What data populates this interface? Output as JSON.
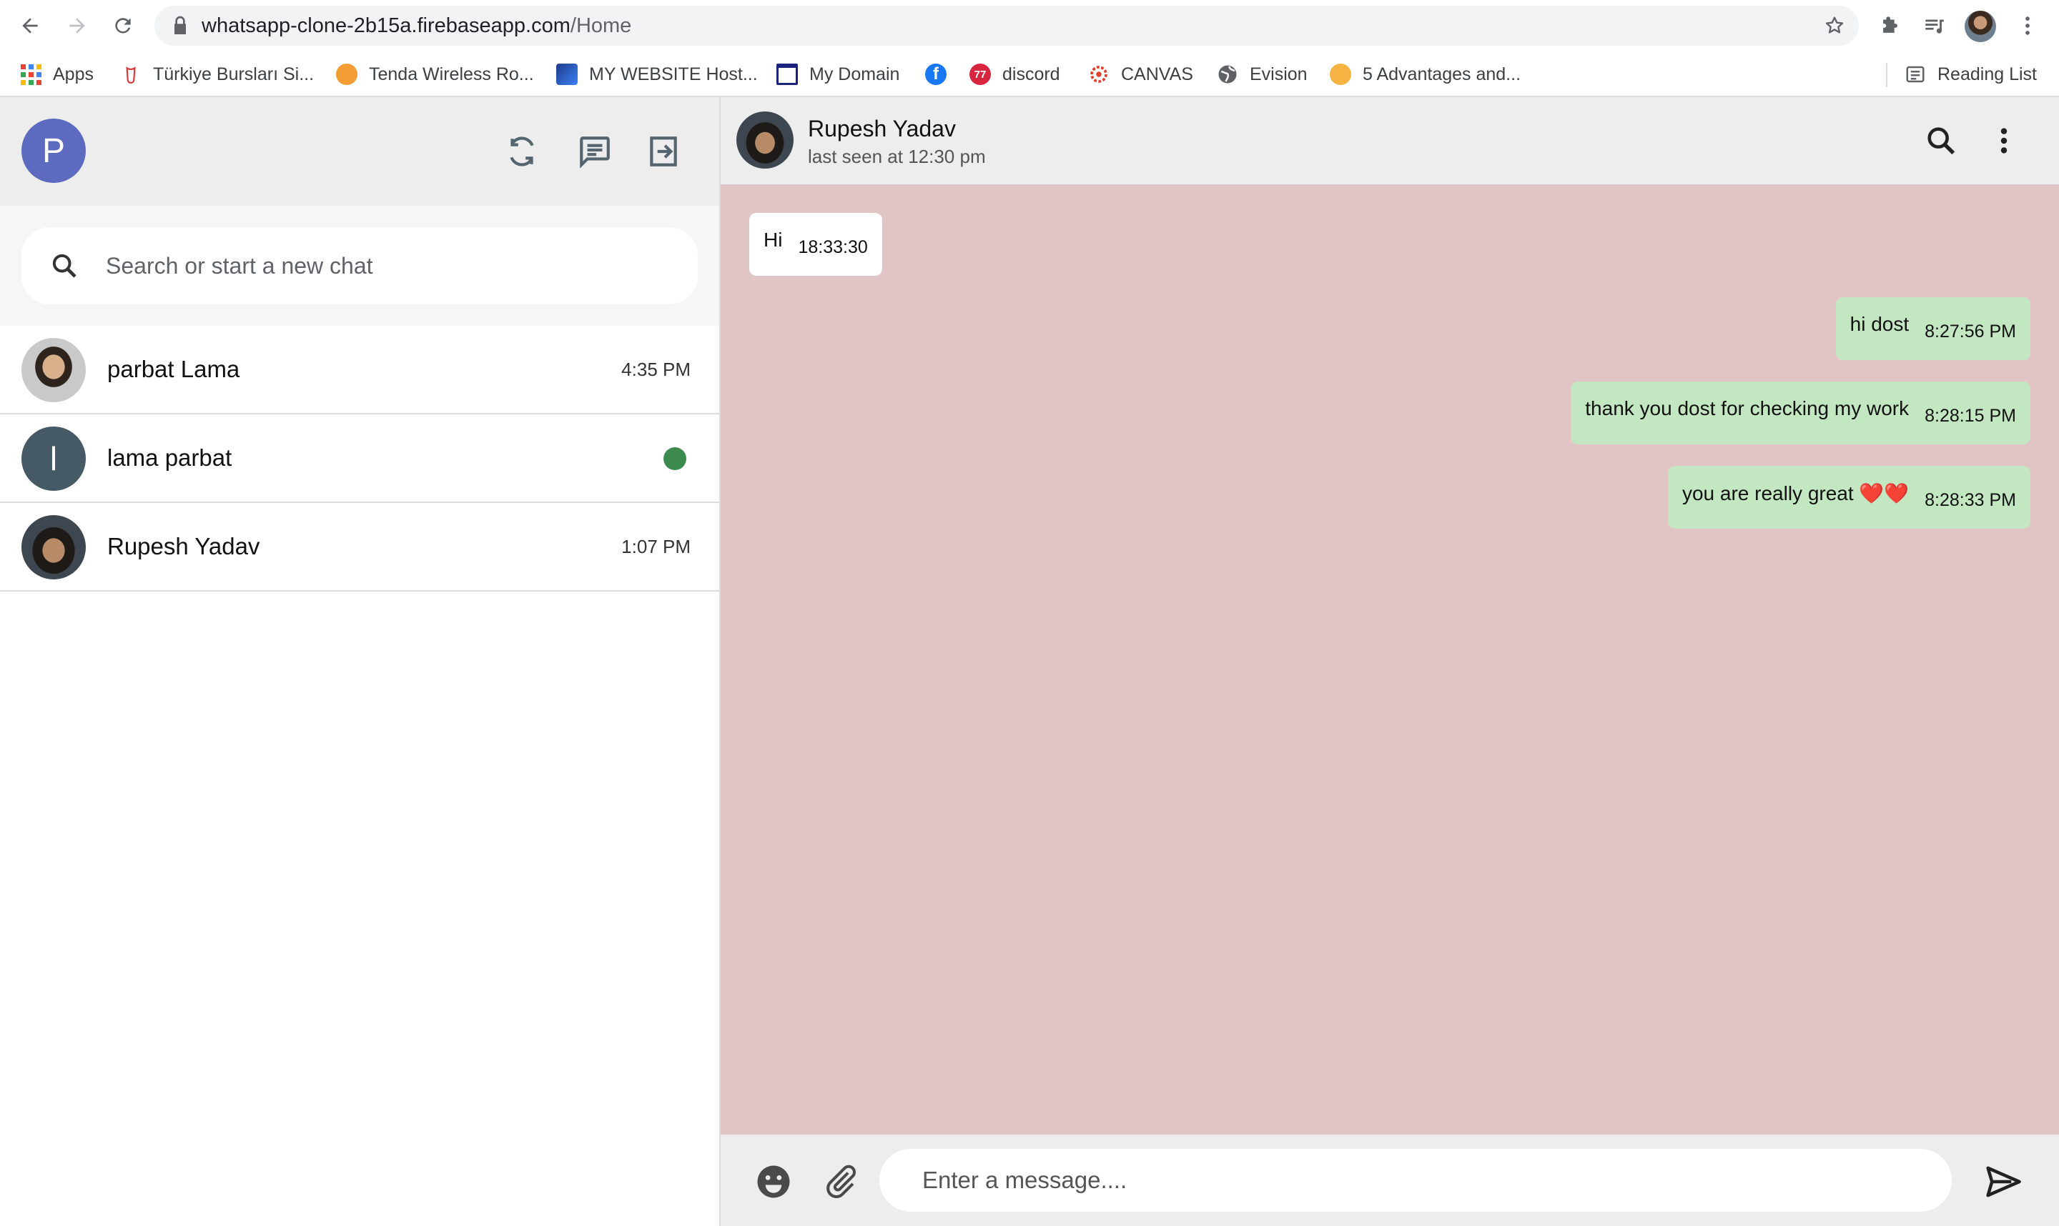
{
  "browser": {
    "url_host": "whatsapp-clone-2b15a.firebaseapp.com",
    "url_path": "/Home",
    "bookmarks": [
      {
        "label": "Apps",
        "icon": "apps-grid-icon"
      },
      {
        "label": "Türkiye Bursları Si...",
        "icon": "turkiye-burslari-icon"
      },
      {
        "label": "Tenda Wireless Ro...",
        "icon": "tenda-icon"
      },
      {
        "label": "MY WEBSITE Host...",
        "icon": "website-host-icon"
      },
      {
        "label": "My Domain",
        "icon": "domain-icon"
      },
      {
        "label": "",
        "icon": "facebook-icon"
      },
      {
        "label": "discord",
        "icon": "discord-icon"
      },
      {
        "label": "CANVAS",
        "icon": "canvas-icon"
      },
      {
        "label": "Evision",
        "icon": "globe-icon"
      },
      {
        "label": "5 Advantages and...",
        "icon": "advantages-icon"
      }
    ],
    "reading_list": "Reading List"
  },
  "sidebar": {
    "user_initial": "P",
    "search_placeholder": "Search or start a new chat",
    "chats": [
      {
        "name": "parbat Lama",
        "time": "4:35 PM",
        "avatar": "photo"
      },
      {
        "name": "lama parbat",
        "time": "",
        "avatar_letter": "l",
        "online": true
      },
      {
        "name": "Rupesh Yadav",
        "time": "1:07 PM",
        "avatar": "photo"
      }
    ]
  },
  "chat": {
    "contact_name": "Rupesh Yadav",
    "last_seen": "last seen at 12:30 pm",
    "messages": [
      {
        "direction": "in",
        "text": "Hi",
        "time": "18:33:30"
      },
      {
        "direction": "out",
        "text": "hi dost",
        "time": "8:27:56 PM"
      },
      {
        "direction": "out",
        "text": "thank you dost for checking my work",
        "time": "8:28:15 PM"
      },
      {
        "direction": "out",
        "text": "you are really great ❤️❤️",
        "time": "8:28:33 PM"
      }
    ],
    "input_placeholder": "Enter a message...."
  },
  "colors": {
    "chat_background": "#e1c4c6",
    "outgoing_bubble": "#c3e8c1",
    "incoming_bubble": "#ffffff",
    "user_avatar": "#5c6bc0",
    "online_dot": "#3d8a4f"
  }
}
